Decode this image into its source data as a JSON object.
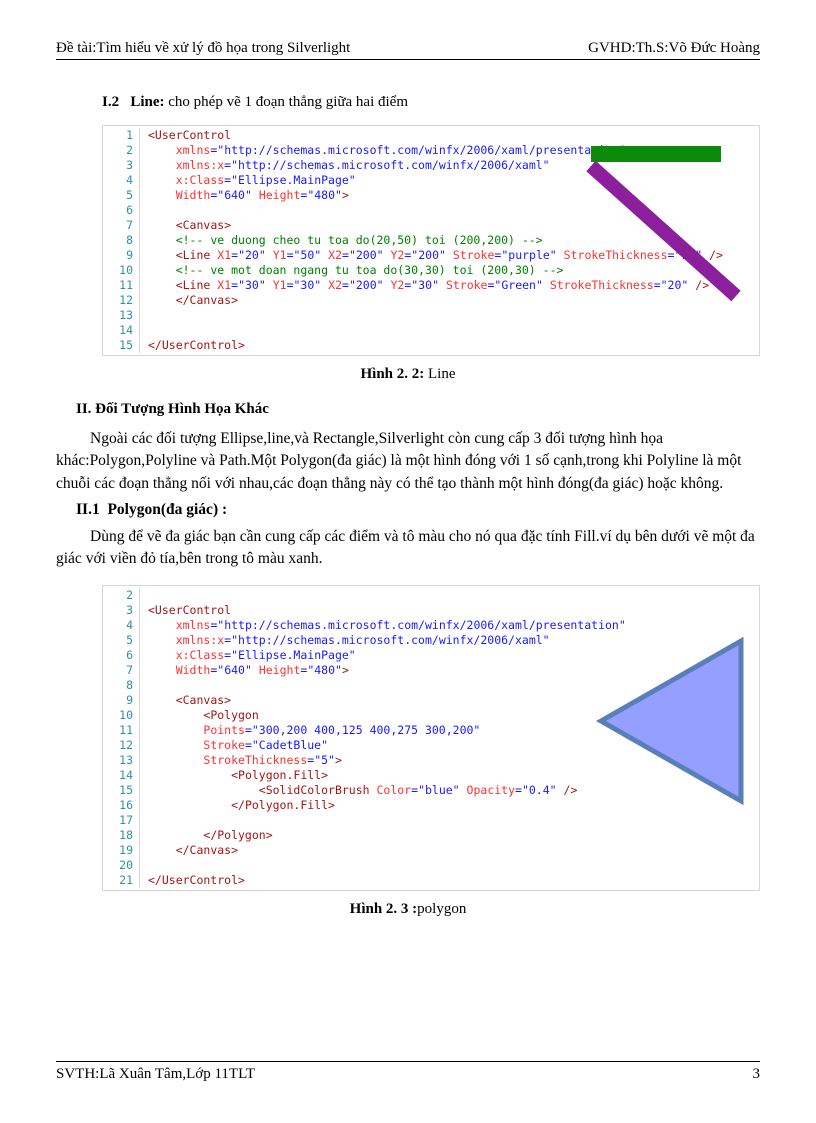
{
  "header": {
    "left": "Đề tài:Tìm hiểu về xử lý đồ họa trong Silverlight",
    "right": "GVHD:Th.S:Võ Đức Hoàng"
  },
  "footer": {
    "left": "SVTH:Lã Xuân Tâm,Lớp 11TLT",
    "page": "3"
  },
  "sec_i2": {
    "num": "I.2",
    "label": "Line:",
    "rest": " cho phép vẽ 1 đoạn thẳng giữa hai điểm"
  },
  "fig1_caption": {
    "bold": "Hình 2. 2: ",
    "rest": "Line"
  },
  "h2": "II. Đối Tượng Hình Họa Khác",
  "para1": "Ngoài các đối tượng Ellipse,line,và Rectangle,Silverlight còn cung cấp 3 đối tượng hình họa khác:Polygon,Polyline và Path.Một Polygon(đa giác) là một hình đóng với 1 số cạnh,trong khi Polyline là một chuỗi các đoạn thẳng nối với nhau,các đoạn thẳng này có thể tạo thành một hình đóng(đa giác) hoặc không.",
  "sec_ii1": {
    "num": "II.1",
    "label": "Polygon(đa giác) :"
  },
  "para2": "Dùng để vẽ đa giác bạn cần cung cấp các điểm và tô màu cho nó qua đặc tính Fill.ví dụ bên dưới vẽ một đa giác với viền đỏ tía,bên trong tô màu xanh.",
  "fig2_caption": {
    "bold": "Hình 2. 3 :",
    "rest": "polygon"
  },
  "code1": {
    "lines": [
      "1",
      "2",
      "3",
      "4",
      "5",
      "6",
      "7",
      "8",
      "9",
      "10",
      "11",
      "12",
      "13",
      "14",
      "15"
    ],
    "l1_open": "<UserControl",
    "l2_attr": "xmlns",
    "l2_val": "\"http://schemas.microsoft.com/winfx/2006/xaml/presentation\"",
    "l3_attr": "xmlns:x",
    "l3_val": "\"http://schemas.microsoft.com/winfx/2006/xaml\"",
    "l4_attr": "x:Class",
    "l4_val": "\"Ellipse.MainPage\"",
    "l5_a1": "Width",
    "l5_v1": "\"640\"",
    "l5_a2": "Height",
    "l5_v2": "\"480\"",
    "l7_canvas": "<Canvas>",
    "l8_cmt": "<!-- ve duong cheo tu toa do(20,50) toi (200,200) -->",
    "l9_line": "<Line",
    "l9_k1": "X1",
    "l9_v1": "\"20\"",
    "l9_k2": "Y1",
    "l9_v2": "\"50\"",
    "l9_k3": "X2",
    "l9_v3": "\"200\"",
    "l9_k4": "Y2",
    "l9_v4": "\"200\"",
    "l9_k5": "Stroke",
    "l9_v5": "\"purple\"",
    "l9_k6": "StrokeThickness",
    "l9_v6": "\"15\"",
    "l10_cmt": "<!-- ve mot doan ngang tu toa do(30,30) toi (200,30) -->",
    "l11_line": "<Line",
    "l11_k1": "X1",
    "l11_v1": "\"30\"",
    "l11_k2": "Y1",
    "l11_v2": "\"30\"",
    "l11_k3": "X2",
    "l11_v3": "\"200\"",
    "l11_k4": "Y2",
    "l11_v4": "\"30\"",
    "l11_k5": "Stroke",
    "l11_v5": "\"Green\"",
    "l11_k6": "StrokeThickness",
    "l11_v6": "\"20\"",
    "l12_close": "</Canvas>",
    "l15_close": "</UserControl>"
  },
  "code2": {
    "lines": [
      "2",
      "3",
      "4",
      "5",
      "6",
      "7",
      "8",
      "9",
      "10",
      "11",
      "12",
      "13",
      "14",
      "15",
      "16",
      "17",
      "18",
      "19",
      "20",
      "21"
    ],
    "l3_open": "<UserControl",
    "l4_attr": "xmlns",
    "l4_val": "\"http://schemas.microsoft.com/winfx/2006/xaml/presentation\"",
    "l5_attr": "xmlns:x",
    "l5_val": "\"http://schemas.microsoft.com/winfx/2006/xaml\"",
    "l6_attr": "x:Class",
    "l6_val": "\"Ellipse.MainPage\"",
    "l7_a1": "Width",
    "l7_v1": "\"640\"",
    "l7_a2": "Height",
    "l7_v2": "\"480\"",
    "l9_canvas": "<Canvas>",
    "l10_poly": "<Polygon",
    "l11_k": "Points",
    "l11_v": "\"300,200 400,125 400,275 300,200\"",
    "l12_k": "Stroke",
    "l12_v": "\"CadetBlue\"",
    "l13_k": "StrokeThickness",
    "l13_v": "\"5\"",
    "l14_fill": "<Polygon.Fill>",
    "l15_tag": "<SolidColorBrush",
    "l15_k1": "Color",
    "l15_v1": "\"blue\"",
    "l15_k2": "Opacity",
    "l15_v2": "\"0.4\"",
    "l16_fillc": "</Polygon.Fill>",
    "l18_polyc": "</Polygon>",
    "l19_canvc": "</Canvas>",
    "l21_close": "</UserControl>"
  }
}
